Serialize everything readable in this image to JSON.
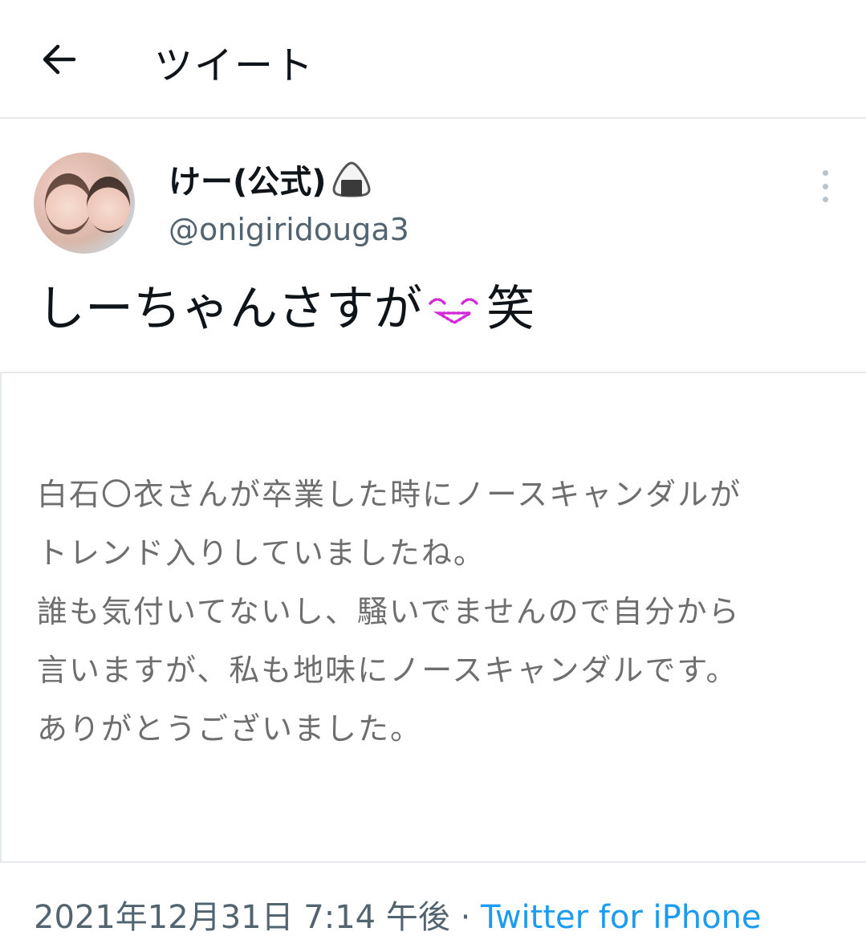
{
  "header": {
    "back_icon": "arrow-left-icon",
    "title": "ツイート"
  },
  "author": {
    "display_name": "けー(公式)",
    "name_emoji": "onigiri-icon",
    "handle": "@onigiridouga3"
  },
  "tweet": {
    "text_before_emoji": "しーちゃんさすが",
    "emoji": "smiling-face-icon",
    "text_after_emoji": "笑"
  },
  "media": {
    "lines": [
      "白石〇衣さんが卒業した時にノースキャンダルが",
      "トレンド入りしていましたね。",
      "誰も気付いてないし、騒いでませんので自分から",
      "言いますが、私も地味にノースキャンダルです。",
      "ありがとうございました。"
    ]
  },
  "meta": {
    "timestamp": "2021年12月31日 7:14 午後",
    "separator": "·",
    "source": "Twitter for iPhone"
  },
  "colors": {
    "text_primary": "#0f1419",
    "text_secondary": "#536471",
    "link": "#1d9bf0",
    "divider": "#e6e9eb",
    "emoji_magenta": "#d12ad6"
  }
}
